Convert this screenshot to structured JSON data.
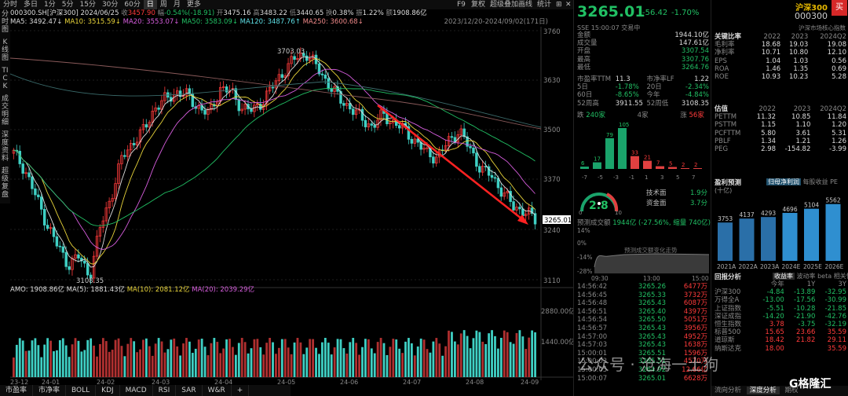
{
  "toolbar": {
    "tabs": [
      "分时",
      "多日",
      "1分",
      "5分",
      "15分",
      "30分",
      "60分",
      "日",
      "周",
      "月",
      "更多"
    ],
    "active": "日",
    "right": [
      "F9",
      "复权",
      "超级叠加",
      "画线",
      "统计",
      "⊞",
      "✕"
    ]
  },
  "side": {
    "groups": [
      "分时图",
      "K线图",
      "TICK",
      "成交明细",
      "深度资料",
      "超级复盘"
    ]
  },
  "info": {
    "code": "000300.SH[沪深300]",
    "date": "2024/06/25",
    "close_label": "收",
    "close": "3457.90",
    "change_label": "幅",
    "change": "-0.54%(-18.91)",
    "open_label": "开",
    "open": "3475.16",
    "high_label": "高",
    "high": "3483.22",
    "low_label": "低",
    "low": "3440.65",
    "swing_label": "换",
    "swing": "0.38%",
    "amp_label": "振",
    "amp": "1.22%",
    "amount_label": "额",
    "amount": "1908.86亿"
  },
  "ma": {
    "ma5": "MA5: 3492.47↓",
    "ma10": "MA10: 3515.59↓",
    "ma20": "MA20: 3553.07↓",
    "ma50": "MA50: 3583.09↓",
    "ma120": "MA120: 3487.76↑",
    "ma250": "MA250: 3600.68↓",
    "range": "2023/12/20-2024/09/02(171日)"
  },
  "main_chart": {
    "price_axis": [
      "3760",
      "3630",
      "3500",
      "3370",
      "3240",
      "3110"
    ],
    "peak_label": "3703.03",
    "low_label": "3108.35",
    "current_tag": "3265.01",
    "x_labels": [
      "23-12",
      "24-01",
      "24-02",
      "24-03",
      "24-04",
      "24-05",
      "24-06",
      "24-07",
      "24-08",
      "24-09"
    ]
  },
  "amo": {
    "label": "AMO: 1908.86亿",
    "ma5": "MA(5): 1881.43亿",
    "ma10": "MA(10): 2081.12亿",
    "ma20": "MA(20): 2039.29亿",
    "axis_top": "2880.00亿",
    "axis_mid": "1440.00亿"
  },
  "bottom_tabs": [
    "市盈率",
    "市净率",
    "BOLL",
    "KDJ",
    "MACD",
    "RSI",
    "SAR",
    "W&R",
    "+"
  ],
  "quote": {
    "price": "3265.01",
    "change": "-56.42",
    "pct": "-1.70%",
    "name": "沪深300",
    "code": "000300",
    "buy": "买",
    "time": "SSE 15:00:07 交易中",
    "subtitle": "沪深市场核心指数",
    "rows": [
      {
        "k": "金额",
        "v": "1944.10亿"
      },
      {
        "k": "成交量",
        "v": "147.61亿"
      },
      {
        "k": "开盘",
        "v": "3307.54"
      },
      {
        "k": "最高",
        "v": "3307.76"
      },
      {
        "k": "最低",
        "v": "3264.76"
      }
    ],
    "pe": {
      "k": "市盈率TTM",
      "v": "11.3",
      "k2": "市净率LF",
      "v2": "1.22"
    },
    "d5": {
      "k": "5日",
      "v": "-1.78%",
      "k2": "20日",
      "v2": "-2.34%"
    },
    "d60": {
      "k": "60日",
      "v": "-8.65%",
      "k2": "今年",
      "v2": "-4.84%"
    },
    "w52": {
      "k": "52周高",
      "v": "3911.55",
      "k2": "52周低",
      "v2": "3108.35"
    },
    "dist": {
      "down_label": "跌",
      "down": "240家",
      "flat": "4家",
      "up_label": "涨",
      "up": "56家"
    }
  },
  "histogram": {
    "labels": [
      "-7",
      "-5",
      "-3",
      "-1",
      "1",
      "3",
      "5",
      "7"
    ],
    "values": [
      6,
      17,
      79,
      105,
      33,
      21,
      7,
      5,
      2,
      2
    ]
  },
  "gauge": {
    "value": "2.8",
    "tech_label": "技术面",
    "tech": "1.9分",
    "fund_label": "资金面",
    "fund": "3.7分",
    "min": "0",
    "max": "10"
  },
  "volume_forecast": {
    "label": "预测成交额",
    "value": "1944亿 (-27.56%, 缩量 740亿)",
    "axis": [
      "14%",
      "0%",
      "-14%",
      "-28%"
    ],
    "title": "预测成交额变化走势",
    "times": [
      "09:30",
      "13:00",
      "15:00"
    ]
  },
  "ticks": [
    {
      "t": "14:56:42",
      "p": "3265.26",
      "v": "6477万"
    },
    {
      "t": "14:56:45",
      "p": "3265.33",
      "v": "3732万"
    },
    {
      "t": "14:56:48",
      "p": "3265.43",
      "v": "6087万"
    },
    {
      "t": "14:56:51",
      "p": "3265.40",
      "v": "4397万"
    },
    {
      "t": "14:56:54",
      "p": "3265.50",
      "v": "5051万"
    },
    {
      "t": "14:56:57",
      "p": "3265.43",
      "v": "3956万"
    },
    {
      "t": "14:57:00",
      "p": "3265.43",
      "v": "4952万"
    },
    {
      "t": "14:57:03",
      "p": "3265.43",
      "v": "1638万"
    },
    {
      "t": "15:00:01",
      "p": "3265.51",
      "v": "1596万"
    },
    {
      "t": "15:00:03",
      "p": "3265.51",
      "v": "4570万"
    },
    {
      "t": "15:00:05",
      "p": "3264.92",
      "v": "12.66亿"
    },
    {
      "t": "15:00:07",
      "p": "3265.01",
      "v": "6628万"
    }
  ],
  "ratios": {
    "title": "关键比率",
    "cols": [
      "2022",
      "2023",
      "2024Q2"
    ],
    "rows": [
      {
        "k": "毛利率",
        "v": [
          "18.68",
          "19.03",
          "19.08"
        ]
      },
      {
        "k": "净利率",
        "v": [
          "10.71",
          "10.80",
          "12.10"
        ]
      },
      {
        "k": "EPS",
        "v": [
          "1.04",
          "1.03",
          "0.56"
        ]
      },
      {
        "k": "ROA",
        "v": [
          "1.46",
          "1.35",
          "0.69"
        ]
      },
      {
        "k": "ROE",
        "v": [
          "10.93",
          "10.23",
          "5.28"
        ]
      }
    ]
  },
  "valuation": {
    "title": "估值",
    "cols": [
      "2022",
      "2023",
      "2024Q2"
    ],
    "rows": [
      {
        "k": "PETTM",
        "v": [
          "11.32",
          "10.85",
          "11.84"
        ]
      },
      {
        "k": "PSTTM",
        "v": [
          "1.15",
          "1.10",
          "1.20"
        ]
      },
      {
        "k": "PCFTTM",
        "v": [
          "5.80",
          "3.61",
          "5.31"
        ]
      },
      {
        "k": "PBLF",
        "v": [
          "1.34",
          "1.21",
          "1.26"
        ]
      },
      {
        "k": "PEG",
        "v": [
          "2.98",
          "-154.82",
          "-3.99"
        ]
      }
    ]
  },
  "forecast": {
    "title": "盈利预测",
    "unit": "(十亿)",
    "tabs": [
      "归母净利润",
      "每股收益",
      "PE"
    ],
    "chart_data": {
      "type": "bar",
      "categories": [
        "2021A",
        "2022A",
        "2023A",
        "2024E",
        "2025E",
        "2026E"
      ],
      "values": [
        3753,
        4137,
        4293,
        4696,
        5104,
        5562
      ]
    }
  },
  "returns": {
    "title": "回报分析",
    "tabs": [
      "收益率",
      "波动率",
      "beta",
      "相关性"
    ],
    "cols": [
      "今年",
      "1Y",
      "3Y"
    ],
    "rows": [
      {
        "k": "沪深300",
        "v": [
          "-4.84",
          "-13.89",
          "-32.95"
        ]
      },
      {
        "k": "万得全A",
        "v": [
          "-13.00",
          "-17.56",
          "-30.99"
        ]
      },
      {
        "k": "上证指数",
        "v": [
          "-5.51",
          "-10.28",
          "-21.85"
        ]
      },
      {
        "k": "深证成指",
        "v": [
          "-14.20",
          "-21.90",
          "-42.76"
        ]
      },
      {
        "k": "恒生指数",
        "v": [
          "3.78",
          "-3.75",
          "-32.19"
        ]
      },
      {
        "k": "标普500",
        "v": [
          "15.65",
          "23.66",
          "35.59"
        ]
      },
      {
        "k": "道琼斯",
        "v": [
          "18.42",
          "21.82",
          "29.11"
        ]
      },
      {
        "k": "纳斯达克",
        "v": [
          "18.00",
          "",
          "35.59"
        ]
      }
    ]
  },
  "panel_tabs": [
    "流向分析",
    "深度分析",
    "期权"
  ],
  "watermark": "公众号 · 沧海一土狗",
  "brand": "G格隆汇"
}
